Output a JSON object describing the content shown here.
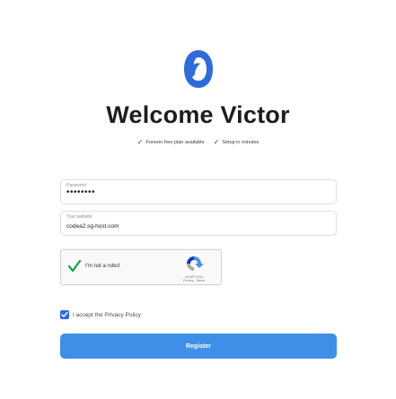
{
  "header": {
    "title": "Welcome Victor",
    "features": [
      {
        "label": "Forever free plan available"
      },
      {
        "label": "Setup in minutes"
      }
    ]
  },
  "form": {
    "password": {
      "label": "Password",
      "value": "••••••••"
    },
    "website": {
      "label": "Your website",
      "value": "codea2.sg-host.com"
    },
    "captcha": {
      "label": "I'm not a robot",
      "brand": "reCAPTCHA",
      "links": "Privacy - Terms"
    },
    "privacy": {
      "label": "I accept the Privacy Policy",
      "checked": true
    },
    "register_label": "Register"
  },
  "colors": {
    "accent": "#3f8ee8",
    "checkbox": "#2f6bd9",
    "logo": "#2f6bd9",
    "captcha_check": "#1a9b49"
  }
}
